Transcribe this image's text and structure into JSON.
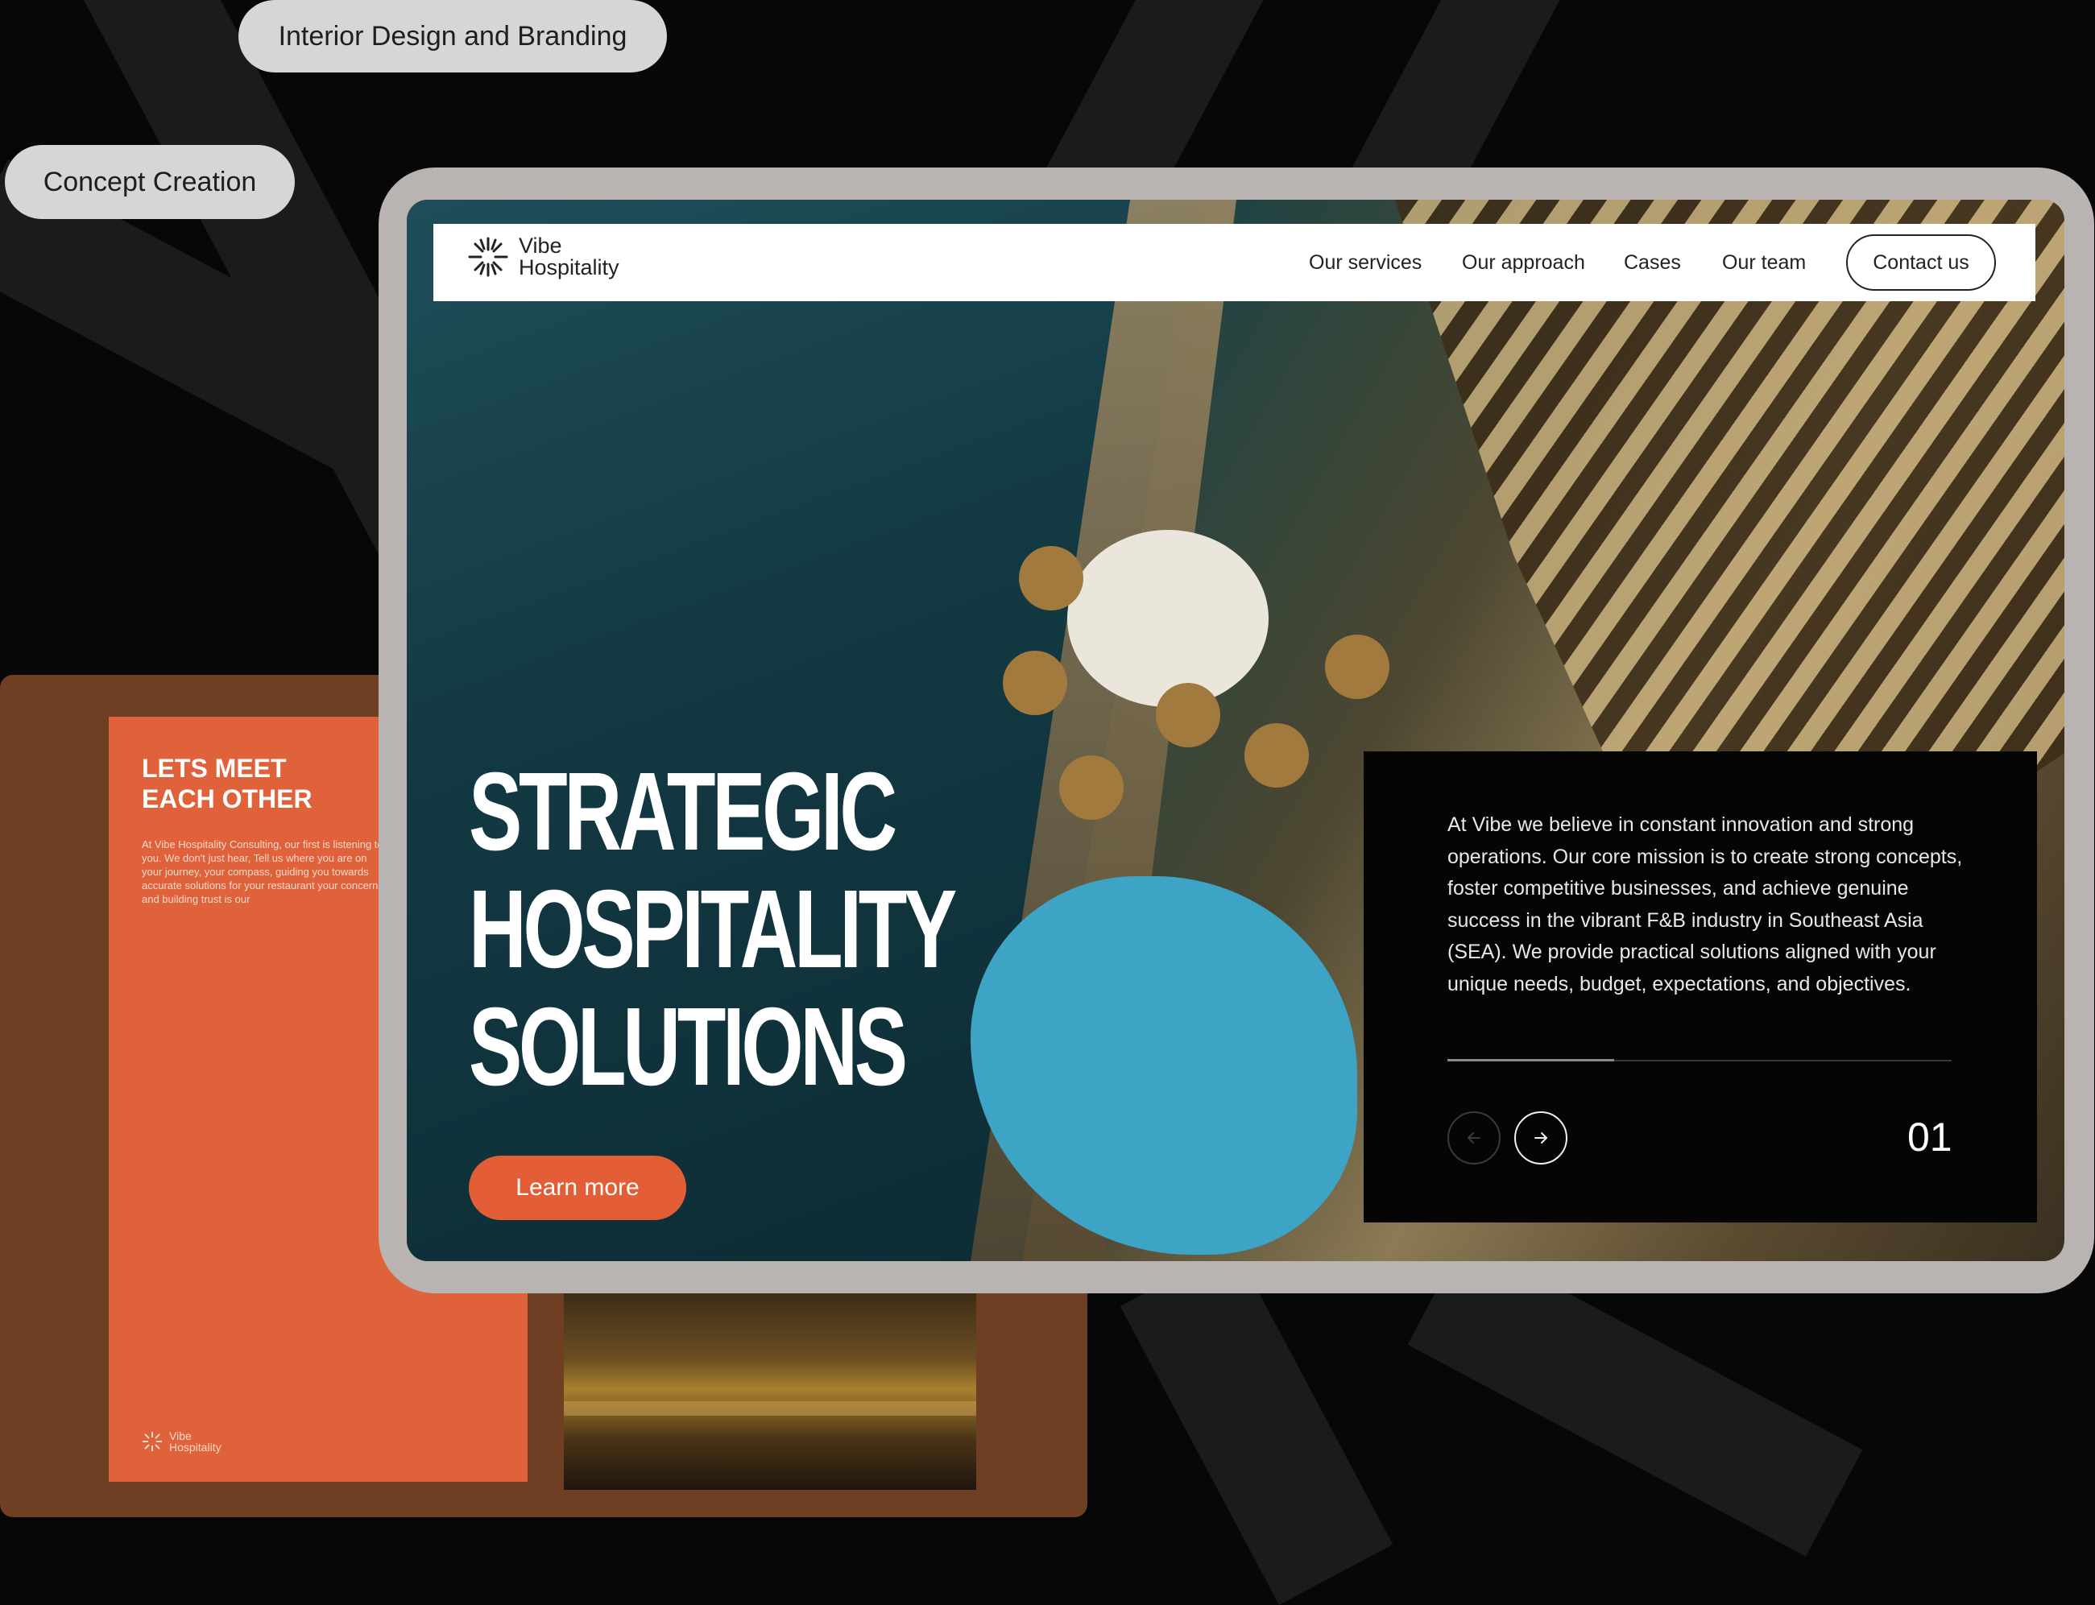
{
  "tags": {
    "interior": "Interior Design and Branding",
    "concept": "Concept Creation"
  },
  "brochure": {
    "heading_line1": "LETS MEET",
    "heading_line2": "EACH OTHER",
    "body": "At Vibe Hospitality Consulting, our first is listening to you. We don't just hear, Tell us where you are on your journey, your compass, guiding you towards accurate solutions for your restaurant your concerns and building trust is our",
    "logo_line1": "Vibe",
    "logo_line2": "Hospitality"
  },
  "site": {
    "logo_line1": "Vibe",
    "logo_line2": "Hospitality",
    "nav": {
      "services": "Our services",
      "approach": "Our approach",
      "cases": "Cases",
      "team": "Our team",
      "contact": "Contact us"
    },
    "hero": {
      "line1": "STRATEGIC",
      "line2": "HOSPITALITY",
      "line3": "SOLUTIONS",
      "cta": "Learn more"
    },
    "panel": {
      "text": "At Vibe we believe in constant innovation and strong operations. Our core mission is to create strong concepts, foster competitive businesses, and achieve genuine success in the vibrant F&B industry  in Southeast Asia (SEA). We provide practical solutions aligned with your unique needs, budget, expectations, and objectives.",
      "counter": "01",
      "progress": 0.33
    }
  },
  "colors": {
    "accent": "#e35d36",
    "background": "#070707"
  }
}
